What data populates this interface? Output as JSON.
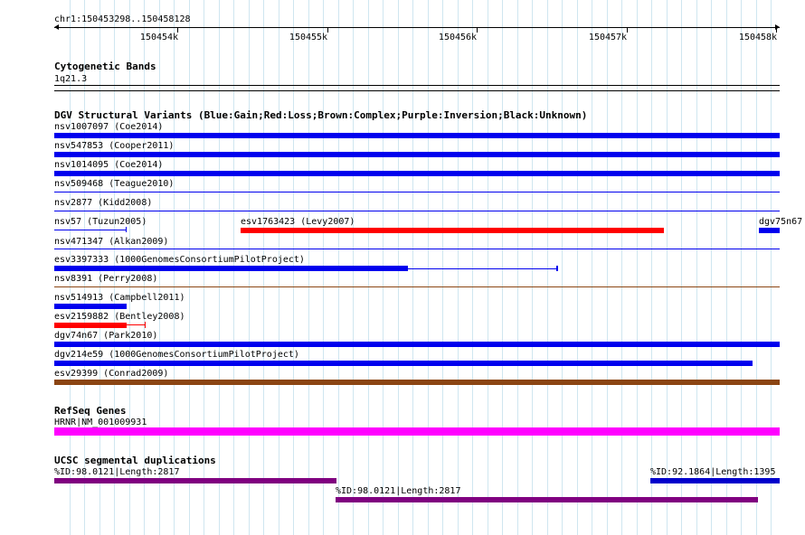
{
  "ruler": {
    "locus": "chr1:150453298..150458128",
    "tick_labels": [
      "150454k",
      "150455k",
      "150456k",
      "150457k",
      "150458k"
    ]
  },
  "tracks": {
    "cytoband": {
      "title": "Cytogenetic Bands",
      "band_label": "1q21.3"
    },
    "dgv": {
      "title": "DGV Structural Variants (Blue:Gain;Red:Loss;Brown:Complex;Purple:Inversion;Black:Unknown)",
      "features": [
        {
          "label": "nsv1007097 (Coe2014)",
          "type": "Gain"
        },
        {
          "label": "nsv547853 (Cooper2011)",
          "type": "Gain"
        },
        {
          "label": "nsv1014095 (Coe2014)",
          "type": "Gain"
        },
        {
          "label": "nsv509468 (Teague2010)",
          "type": "Gain"
        },
        {
          "label": "nsv2877 (Kidd2008)",
          "type": "Gain"
        },
        {
          "label": "nsv57 (Tuzun2005)",
          "type": "Gain"
        },
        {
          "label": "esv1763423 (Levy2007)",
          "type": "Loss"
        },
        {
          "label": "dgv75n67",
          "type": "Gain"
        },
        {
          "label": "nsv471347 (Alkan2009)",
          "type": "Gain"
        },
        {
          "label": "esv3397333 (1000GenomesConsortiumPilotProject)",
          "type": "Gain"
        },
        {
          "label": "nsv8391 (Perry2008)",
          "type": "Complex"
        },
        {
          "label": "nsv514913 (Campbell2011)",
          "type": "Gain"
        },
        {
          "label": "esv2159882 (Bentley2008)",
          "type": "Loss"
        },
        {
          "label": "dgv74n67 (Park2010)",
          "type": "Gain"
        },
        {
          "label": "dgv214e59 (1000GenomesConsortiumPilotProject)",
          "type": "Gain"
        },
        {
          "label": "esv29399 (Conrad2009)",
          "type": "Complex"
        }
      ]
    },
    "refseq": {
      "title": "RefSeq Genes",
      "gene_label": "HRNR|NM_001009931"
    },
    "segdup": {
      "title": "UCSC segmental duplications",
      "features": [
        {
          "label": "%ID:98.0121|Length:2817"
        },
        {
          "label": "%ID:92.1864|Length:1395"
        },
        {
          "label": "%ID:98.0121|Length:2817"
        }
      ]
    }
  },
  "colors": {
    "gain": "#0000ee",
    "loss": "#ff0000",
    "complex": "#8b4513",
    "refseq": "#ff00ff",
    "segdup_purple": "#800080",
    "segdup_blue": "#0000cc",
    "grid": "#cfe6f0"
  }
}
